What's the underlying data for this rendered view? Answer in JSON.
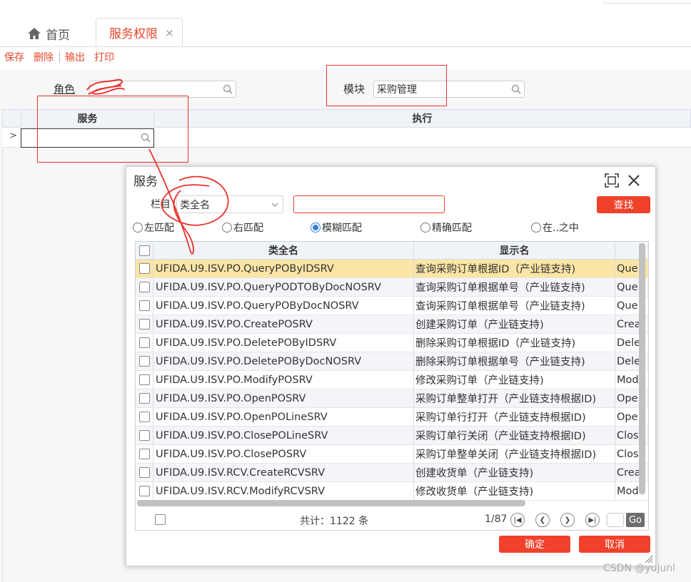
{
  "tabs": [
    {
      "label": "首页",
      "icon": "home-icon"
    },
    {
      "label": "服务权限",
      "close": "×"
    }
  ],
  "toolbar": {
    "save": "保存",
    "delete": "删除",
    "export": "输出",
    "print": "打印"
  },
  "filter": {
    "role_label": "角色",
    "role_value": "",
    "module_label": "模块",
    "module_value": "采购管理"
  },
  "grid": {
    "headers": {
      "service": "服务",
      "execute": "执行"
    },
    "row_marker": ">"
  },
  "dialog": {
    "title": "服务",
    "column_label": "栏目",
    "column_value": "类全名",
    "search_value": "",
    "search_button": "查找",
    "match_modes": [
      {
        "label": "左匹配",
        "checked": false
      },
      {
        "label": "右匹配",
        "checked": false
      },
      {
        "label": "模糊匹配",
        "checked": true
      },
      {
        "label": "精确匹配",
        "checked": false
      },
      {
        "label": "在..之中",
        "checked": false
      }
    ],
    "table": {
      "headers": {
        "class_name": "类全名",
        "display_name": "显示名"
      },
      "rows": [
        {
          "class_name": "UFIDA.U9.ISV.PO.QueryPOByIDSRV",
          "display_name": "查询采购订单根据ID（产业链支持)",
          "extra": "Que"
        },
        {
          "class_name": "UFIDA.U9.ISV.PO.QueryPODTOByDocNOSRV",
          "display_name": "查询采购订单根据单号（产业链支持)",
          "extra": "Que"
        },
        {
          "class_name": "UFIDA.U9.ISV.PO.QueryPOByDocNOSRV",
          "display_name": "查询采购订单根据单号（产业链支持)",
          "extra": "Que"
        },
        {
          "class_name": "UFIDA.U9.ISV.PO.CreatePOSRV",
          "display_name": "创建采购订单（产业链支持)",
          "extra": "Crea"
        },
        {
          "class_name": "UFIDA.U9.ISV.PO.DeletePOByIDSRV",
          "display_name": "删除采购订单根据ID（产业链支持)",
          "extra": "Dele"
        },
        {
          "class_name": "UFIDA.U9.ISV.PO.DeletePOByDocNOSRV",
          "display_name": "删除采购订单根据单号（产业链支持)",
          "extra": "Dele"
        },
        {
          "class_name": "UFIDA.U9.ISV.PO.ModifyPOSRV",
          "display_name": "修改采购订单（产业链支持)",
          "extra": "Mod"
        },
        {
          "class_name": "UFIDA.U9.ISV.PO.OpenPOSRV",
          "display_name": "采购订单整单打开（产业链支持根据ID)",
          "extra": "Ope"
        },
        {
          "class_name": "UFIDA.U9.ISV.PO.OpenPOLineSRV",
          "display_name": "采购订单行打开（产业链支持根据ID)",
          "extra": "Ope"
        },
        {
          "class_name": "UFIDA.U9.ISV.PO.ClosePOLineSRV",
          "display_name": "采购订单行关闭（产业链支持根据ID)",
          "extra": "Clos"
        },
        {
          "class_name": "UFIDA.U9.ISV.PO.ClosePOSRV",
          "display_name": "采购订单整单关闭（产业链支持根据ID)",
          "extra": "Clos"
        },
        {
          "class_name": "UFIDA.U9.ISV.RCV.CreateRCVSRV",
          "display_name": "创建收货单（产业链支持)",
          "extra": "Crea"
        },
        {
          "class_name": "UFIDA.U9.ISV.RCV.ModifyRCVSRV",
          "display_name": "修改收货单（产业链支持)",
          "extra": "Mod"
        }
      ]
    },
    "footer": {
      "total": "共计：1122 条",
      "page": "1/87",
      "go": "Go",
      "page_input": ""
    },
    "ok_button": "确定",
    "cancel_button": "取消"
  },
  "watermark": "CSDN @yujunl",
  "colors": {
    "accent": "#e8452b",
    "button": "#f0412b",
    "selected_row": "#fbe5a5",
    "radio": "#3b7ddd",
    "annotation": "#e8322b"
  }
}
